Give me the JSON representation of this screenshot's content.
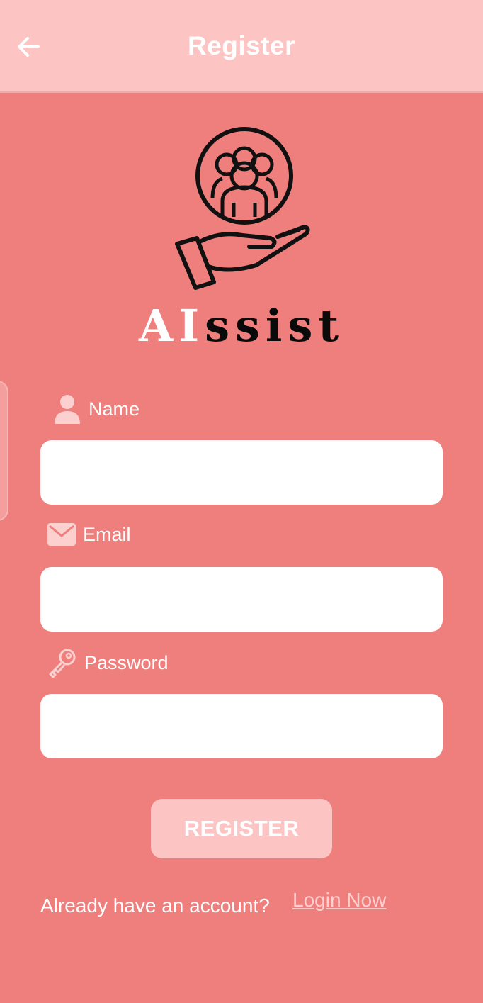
{
  "appbar": {
    "title": "Register",
    "back_icon": "arrow-left-icon"
  },
  "logo": {
    "brand_ai": "AI",
    "brand_rest": "ssist",
    "icon": "hand-holding-people-icon"
  },
  "form": {
    "name": {
      "label": "Name",
      "icon": "person-icon",
      "value": "",
      "placeholder": ""
    },
    "email": {
      "label": "Email",
      "icon": "envelope-icon",
      "value": "",
      "placeholder": ""
    },
    "password": {
      "label": "Password",
      "icon": "key-icon",
      "value": "",
      "placeholder": ""
    }
  },
  "actions": {
    "register_label": "REGISTER"
  },
  "footer": {
    "prompt": "Already have an account?",
    "login_link": "Login Now"
  },
  "colors": {
    "background": "#ef7f7d",
    "appbar": "#fdc4c4",
    "button": "#fdc4c4",
    "label_icon": "#fdd0d0"
  }
}
